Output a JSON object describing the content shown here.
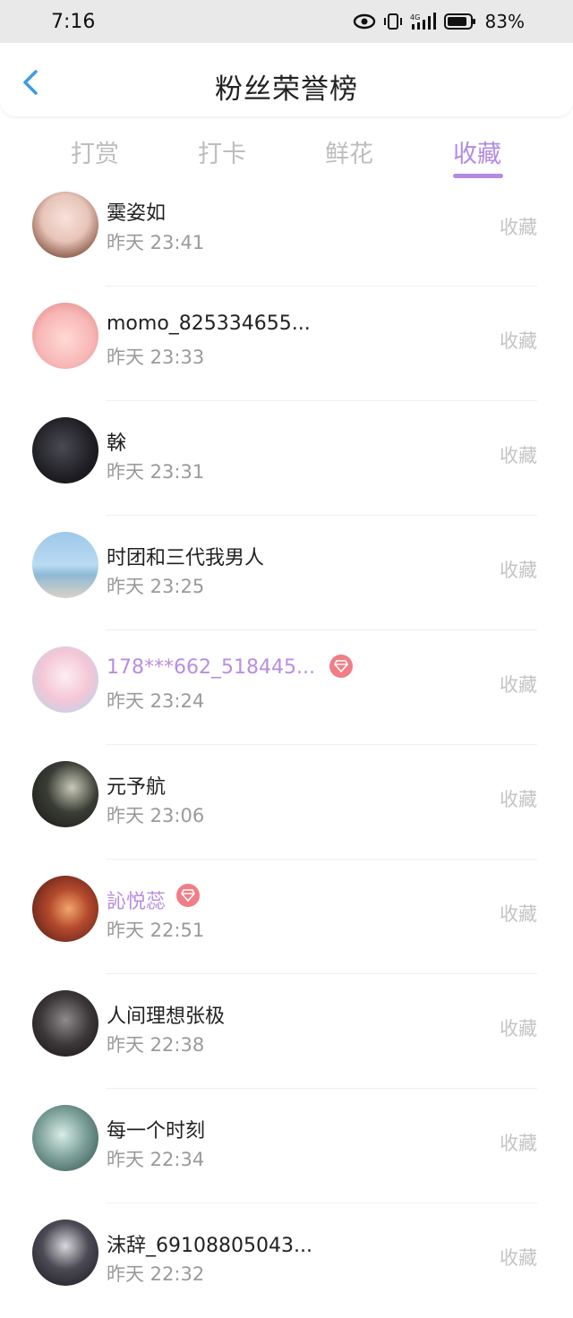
{
  "status_bar": {
    "time": "7:16",
    "battery": "83%",
    "icons": [
      "eye-icon",
      "vibrate-icon",
      "signal-4g-icon",
      "battery-icon"
    ]
  },
  "header": {
    "title": "粉丝荣誉榜",
    "back_icon": "chevron-left-icon"
  },
  "tabs": [
    {
      "label": "打赏",
      "active": false
    },
    {
      "label": "打卡",
      "active": false
    },
    {
      "label": "鲜花",
      "active": false
    },
    {
      "label": "收藏",
      "active": true
    }
  ],
  "colors": {
    "accent": "#b28ae3",
    "vip_name": "#b88ee0",
    "vip_badge": "#f07e86",
    "muted": "#9a9a9a",
    "action": "#c4c4c4"
  },
  "rows": [
    {
      "name": "霙姿如",
      "time": "昨天 23:41",
      "action": "收藏",
      "vip": false
    },
    {
      "name": "momo_825334655...",
      "time": "昨天 23:33",
      "action": "收藏",
      "vip": false
    },
    {
      "name": "榦",
      "time": "昨天 23:31",
      "action": "收藏",
      "vip": false
    },
    {
      "name": "时团和三代我男人",
      "time": "昨天 23:25",
      "action": "收藏",
      "vip": false
    },
    {
      "name": "178***662_518445...",
      "time": "昨天 23:24",
      "action": "收藏",
      "vip": true
    },
    {
      "name": "元予航",
      "time": "昨天 23:06",
      "action": "收藏",
      "vip": false
    },
    {
      "name": "訫悦蕊",
      "time": "昨天 22:51",
      "action": "收藏",
      "vip": true
    },
    {
      "name": "人间理想张极",
      "time": "昨天 22:38",
      "action": "收藏",
      "vip": false
    },
    {
      "name": "每一个时刻",
      "time": "昨天 22:34",
      "action": "收藏",
      "vip": false
    },
    {
      "name": "沫辞_69108805043...",
      "time": "昨天 22:32",
      "action": "收藏",
      "vip": false
    }
  ]
}
